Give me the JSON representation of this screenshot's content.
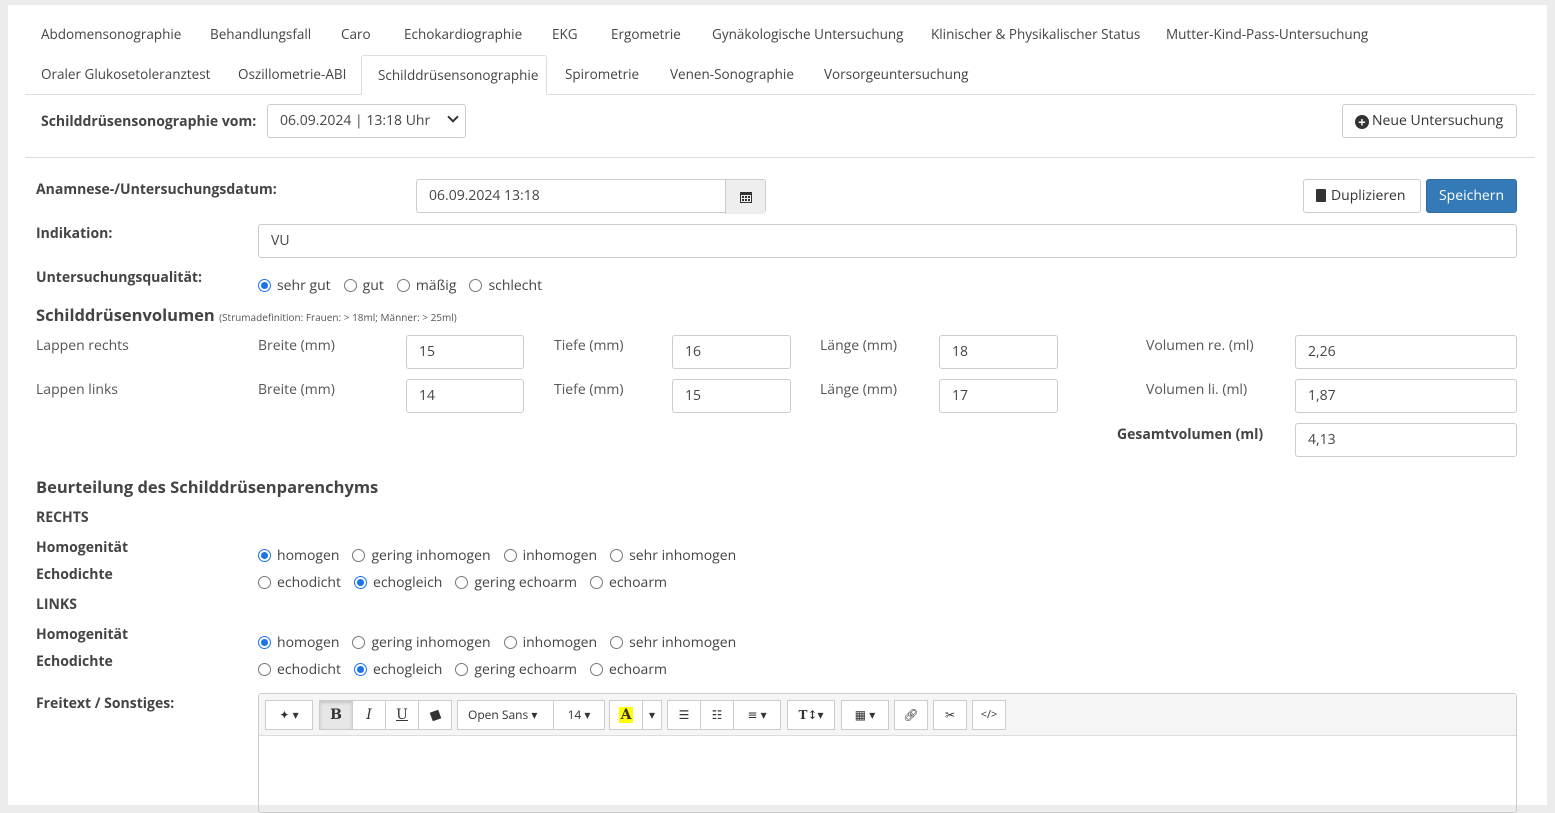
{
  "tabs": [
    {
      "label": "Abdomensonographie"
    },
    {
      "label": "Behandlungsfall"
    },
    {
      "label": "Caro"
    },
    {
      "label": "Echokardiographie"
    },
    {
      "label": "EKG"
    },
    {
      "label": "Ergometrie"
    },
    {
      "label": "Gynäkologische Untersuchung"
    },
    {
      "label": "Klinischer & Physikalischer Status"
    },
    {
      "label": "Mutter-Kind-Pass-Untersuchung"
    },
    {
      "label": "Oraler Glukosetoleranztest"
    },
    {
      "label": "Oszillometrie-ABI"
    },
    {
      "label": "Schilddrüsensonographie"
    },
    {
      "label": "Spirometrie"
    },
    {
      "label": "Venen-Sonographie"
    },
    {
      "label": "Vorsorgeuntersuchung"
    }
  ],
  "header": {
    "vom_label": "Schilddrüsensonographie vom:",
    "vom_value": "06.09.2024 | 13:18 Uhr",
    "new_button": "Neue Untersuchung"
  },
  "form": {
    "date_label": "Anamnese-/Untersuchungsdatum:",
    "date_value": "06.09.2024 13:18",
    "duplicate_button": "Duplizieren",
    "save_button": "Speichern",
    "indikation_label": "Indikation:",
    "indikation_value": "VU",
    "quality_label": "Untersuchungsqualität:",
    "quality_options": [
      "sehr gut",
      "gut",
      "mäßig",
      "schlecht"
    ],
    "quality_selected": "sehr gut"
  },
  "volume": {
    "title": "Schilddrüsenvolumen",
    "subtitle": "(Strumadefinition: Frauen: > 18ml; Männer: > 25ml)",
    "breite_label": "Breite (mm)",
    "tiefe_label": "Tiefe (mm)",
    "laenge_label": "Länge (mm)",
    "right": {
      "label": "Lappen rechts",
      "breite": "15",
      "tiefe": "16",
      "laenge": "18",
      "vol_label": "Volumen re. (ml)",
      "vol": "2,26"
    },
    "left": {
      "label": "Lappen links",
      "breite": "14",
      "tiefe": "15",
      "laenge": "17",
      "vol_label": "Volumen li.  (ml)",
      "vol": "1,87"
    },
    "total_label": "Gesamtvolumen (ml)",
    "total": "4,13"
  },
  "parenchym": {
    "title": "Beurteilung des Schilddrüsenparenchyms",
    "rechts": "RECHTS",
    "links": "LINKS",
    "homogen_label": "Homogenität",
    "echo_label": "Echodichte",
    "homogen_options": [
      "homogen",
      "gering inhomogen",
      "inhomogen",
      "sehr inhomogen"
    ],
    "echo_options": [
      "echodicht",
      "echogleich",
      "gering echoarm",
      "echoarm"
    ],
    "rechts_homogen": "homogen",
    "rechts_echo": "echogleich",
    "links_homogen": "homogen",
    "links_echo": "echogleich"
  },
  "freitext": {
    "label": "Freitext / Sonstiges:",
    "font_name": "Open Sans",
    "font_size": "14",
    "bold": "B",
    "italic": "I",
    "underline": "U"
  },
  "colors": {
    "primary": "#337ab7",
    "radio": "#1a73e8"
  }
}
